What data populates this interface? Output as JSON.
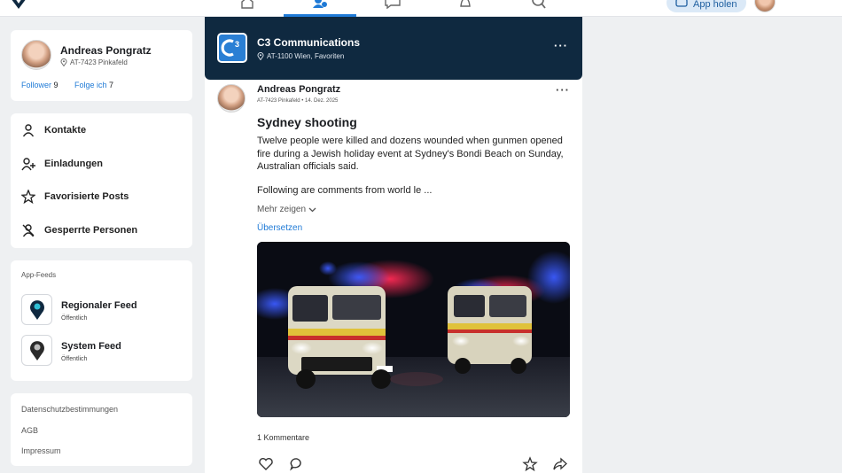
{
  "profile": {
    "name": "Andreas Pongratz",
    "location": "AT-7423 Pinkafeld",
    "followers_label": "Follower",
    "followers_count": "9",
    "following_label": "Folge ich",
    "following_count": "7"
  },
  "menu": {
    "items": [
      {
        "label": "Kontakte",
        "icon": "person-icon"
      },
      {
        "label": "Einladungen",
        "icon": "person-add-icon"
      },
      {
        "label": "Favorisierte Posts",
        "icon": "star-icon"
      },
      {
        "label": "Gesperrte Personen",
        "icon": "person-blocked-icon"
      }
    ]
  },
  "feeds": {
    "title": "App-Feeds",
    "items": [
      {
        "name": "Regionaler Feed",
        "visibility": "Öffentlich"
      },
      {
        "name": "System Feed",
        "visibility": "Öffentlich"
      }
    ]
  },
  "legal": {
    "links": [
      "Datenschutzbestimmungen",
      "AGB",
      "Impressum"
    ]
  },
  "topbar": {
    "app_button_label": "App holen",
    "active_nav": "community-icon",
    "accent": "#1f7ad6"
  },
  "group": {
    "name": "C3 Communications",
    "location": "AT-1100 Wien, Favoriten",
    "logo_text": "C3",
    "header_color": "#0f2940"
  },
  "post": {
    "author": "Andreas Pongratz",
    "meta": "AT-7423 Pinkafeld • 14. Dez. 2025",
    "title": "Sydney shooting",
    "body": "Twelve people were killed and dozens wounded when gunmen opened fire during a Jewish holiday event at Sydney's Bondi Beach on Sunday, Australian officials said.",
    "body_more": "Following are comments from world le ...",
    "show_more": "Mehr zeigen",
    "translate": "Übersetzen",
    "comments": "1 Kommentare"
  }
}
